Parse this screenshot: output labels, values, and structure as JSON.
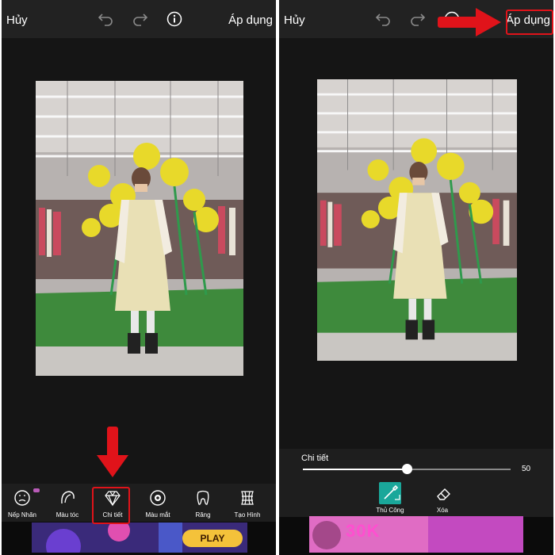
{
  "left": {
    "cancel_label": "Hủy",
    "apply_label": "Áp dụng",
    "tools": [
      {
        "label": "Nếp Nhăn",
        "icon": "wrinkle-face-icon"
      },
      {
        "label": "Màu tóc",
        "icon": "hair-color-icon"
      },
      {
        "label": "Chi tiết",
        "icon": "diamond-icon"
      },
      {
        "label": "Màu mắt",
        "icon": "eye-color-icon"
      },
      {
        "label": "Răng",
        "icon": "tooth-icon"
      },
      {
        "label": "Tạo Hình",
        "icon": "reshape-icon"
      }
    ],
    "selected_tool": "Chi tiết",
    "ad_button": "PLAY"
  },
  "right": {
    "cancel_label": "Hủy",
    "apply_label": "Áp dụng",
    "slider": {
      "label": "Chi tiết",
      "value": 50,
      "min": 0,
      "max": 100
    },
    "modes": [
      {
        "label": "Thủ Công",
        "icon": "brush-icon"
      },
      {
        "label": "Xóa",
        "icon": "eraser-icon"
      }
    ],
    "ad_text": "30K"
  },
  "colors": {
    "toolbar_bg": "#222222",
    "highlight": "#e0131a",
    "manual_mode": "#1aa79a"
  }
}
